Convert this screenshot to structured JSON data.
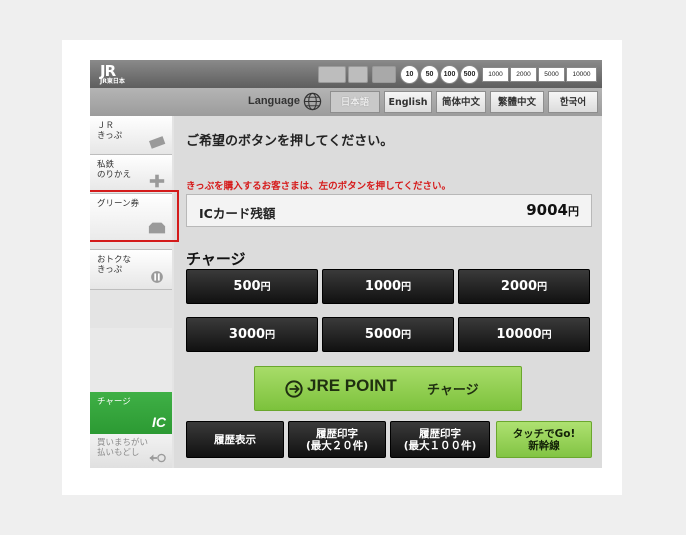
{
  "header": {
    "logo_main": "JR",
    "logo_sub": "JR東日本",
    "coins": [
      "10",
      "50",
      "100",
      "500"
    ],
    "bills": [
      "1000",
      "2000",
      "5000",
      "10000"
    ]
  },
  "language_bar": {
    "label": "Language",
    "languages": [
      "日本語",
      "English",
      "简体中文",
      "繁體中文",
      "한국어"
    ],
    "selected": "日本語"
  },
  "sidebar": {
    "items": [
      {
        "label": "ＪＲ\nきっぷ"
      },
      {
        "label": "私鉄\nのりかえ"
      },
      {
        "label": "グリーン券"
      },
      {
        "label": "おトクな\nきっぷ"
      }
    ],
    "charge": {
      "label": "チャージ",
      "icon_text": "IC"
    },
    "mistake": {
      "label": "買いまちがい\n払いもどし"
    }
  },
  "main": {
    "instruction": "ご希望のボタンを押してください。",
    "notice": "きっぷを購入するお客さまは、左のボタンを押してください。",
    "balance": {
      "label": "ICカード残額",
      "value": "9004",
      "unit": "円"
    },
    "charge_title": "チャージ",
    "amounts": [
      {
        "value": "500",
        "unit": "円"
      },
      {
        "value": "1000",
        "unit": "円"
      },
      {
        "value": "2000",
        "unit": "円"
      },
      {
        "value": "3000",
        "unit": "円"
      },
      {
        "value": "5000",
        "unit": "円"
      },
      {
        "value": "10000",
        "unit": "円"
      }
    ],
    "jre_point": {
      "brand": "JRE POINT",
      "action": "チャージ"
    },
    "history": [
      {
        "line1": "履歴表示",
        "line2": ""
      },
      {
        "line1": "履歴印字",
        "line2": "(最大２０件)"
      },
      {
        "line1": "履歴印字",
        "line2": "(最大１００件)"
      }
    ],
    "go": {
      "line1": "タッチでGo!",
      "line2": "新幹線"
    }
  },
  "colors": {
    "highlight": "#d41b1b",
    "charge_green": "#3fb046",
    "jre_green": "#8fcf4f",
    "notice_red": "#d61b1b"
  }
}
